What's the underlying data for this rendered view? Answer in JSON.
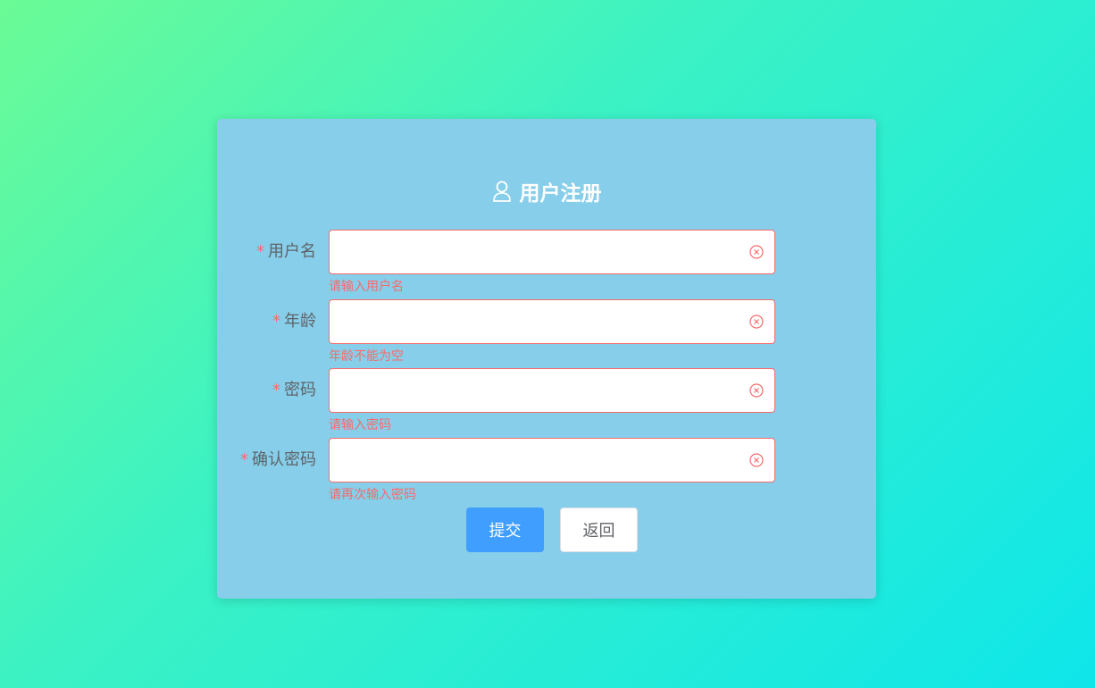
{
  "form": {
    "title": "用户注册",
    "title_icon": "user-icon",
    "required_mark": "*",
    "fields": [
      {
        "label": "用户名",
        "value": "",
        "placeholder": "",
        "error": "请输入用户名",
        "input_type": "text"
      },
      {
        "label": "年龄",
        "value": "",
        "placeholder": "",
        "error": "年龄不能为空",
        "input_type": "text"
      },
      {
        "label": "密码",
        "value": "",
        "placeholder": "",
        "error": "请输入密码",
        "input_type": "password"
      },
      {
        "label": "确认密码",
        "value": "",
        "placeholder": "",
        "error": "请再次输入密码",
        "input_type": "password"
      }
    ],
    "buttons": {
      "submit_label": "提交",
      "back_label": "返回"
    }
  },
  "colors": {
    "card_background": "#87ceea",
    "error": "#f56c6c",
    "primary": "#409eff",
    "label_text": "#5f6368",
    "gradient_start": "#6bfb96",
    "gradient_end": "#0fe6ea"
  }
}
